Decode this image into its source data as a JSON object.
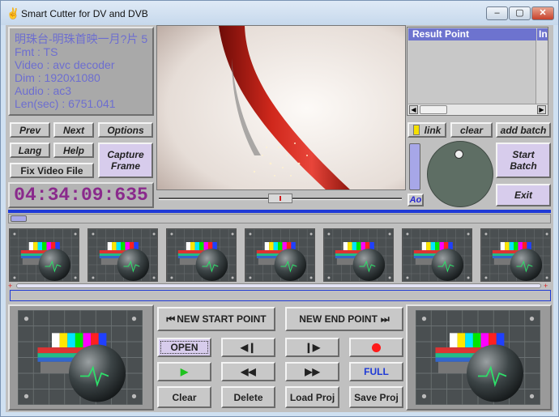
{
  "window": {
    "title": "Smart Cutter for DV and DVB",
    "minimize": "–",
    "maximize": "▢",
    "close": "✕"
  },
  "info": {
    "line1": "明珠台-明珠首映一月?片 5",
    "fmt": "Fmt : TS",
    "video": "Video : avc decoder",
    "dim": "Dim : 1920x1080",
    "audio": "Audio : ac3",
    "len": "Len(sec) : 6751.041"
  },
  "buttons": {
    "prev": "Prev",
    "next": "Next",
    "options": "Options",
    "lang": "Lang",
    "help": "Help",
    "capture_frame_1": "Capture",
    "capture_frame_2": "Frame",
    "fix_video": "Fix Video File",
    "link": "link",
    "clear_result": "clear",
    "add_batch": "add batch",
    "start_batch_1": "Start",
    "start_batch_2": "Batch",
    "exit": "Exit",
    "ao": "Ao",
    "new_start": "NEW START POINT",
    "new_end": "NEW END POINT",
    "open": "OPEN",
    "full": "FULL",
    "clear": "Clear",
    "delete": "Delete",
    "load_proj": "Load Proj",
    "save_proj": "Save Proj"
  },
  "timecode": "04:34:09:635",
  "result": {
    "col1": "Result Point",
    "col2": "In"
  },
  "colors": {
    "accent_blue": "#1f3ad6",
    "record_red": "#ff1a1a",
    "play_green": "#1ec21e",
    "timecode": "#8a2a8c",
    "info_text": "#6d6ed0"
  }
}
